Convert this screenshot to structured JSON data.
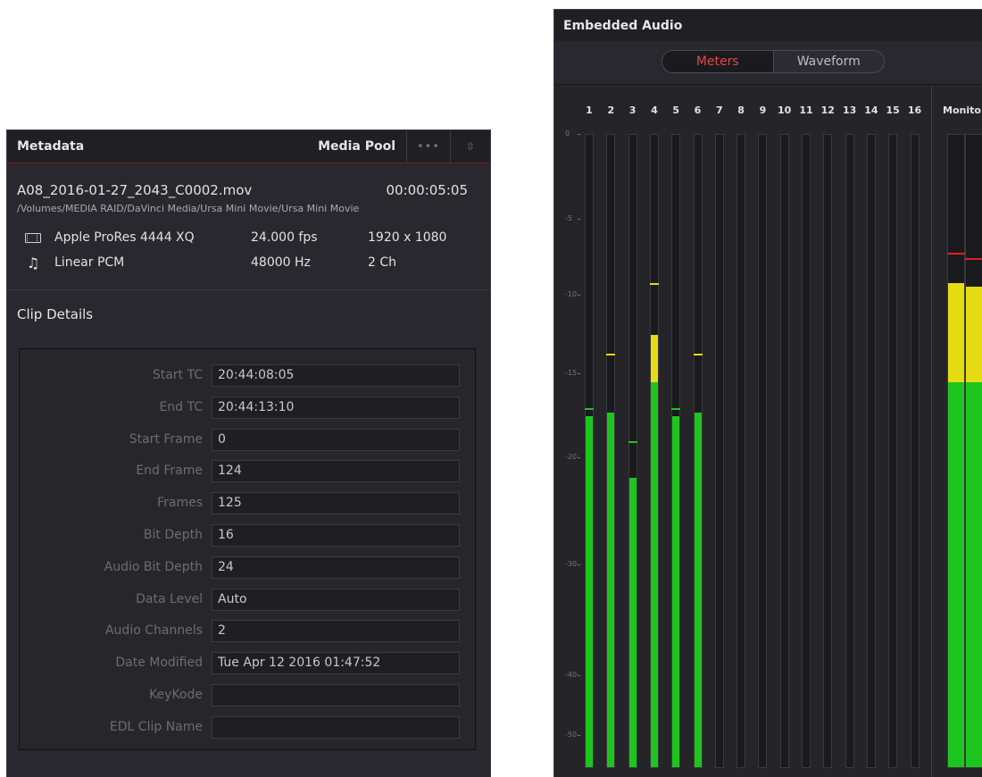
{
  "metadata_panel": {
    "title": "Metadata",
    "media_pool_label": "Media Pool",
    "more_label": "•••",
    "sort_label": "⇳",
    "file_name": "A08_2016-01-27_2043_C0002.mov",
    "duration": "00:00:05:05",
    "file_path": "/Volumes/MEDIA RAID/DaVinci Media/Ursa Mini Movie/Ursa Mini Movie",
    "video": {
      "icon": "film-icon",
      "codec": "Apple ProRes 4444 XQ",
      "fps": "24.000 fps",
      "resolution": "1920 x 1080"
    },
    "audio": {
      "icon": "music-note-icon",
      "codec": "Linear PCM",
      "rate": "48000 Hz",
      "channels": "2 Ch"
    },
    "clip_details_title": "Clip Details",
    "details": [
      {
        "label": "Start TC",
        "value": "20:44:08:05"
      },
      {
        "label": "End TC",
        "value": "20:44:13:10"
      },
      {
        "label": "Start Frame",
        "value": "0"
      },
      {
        "label": "End Frame",
        "value": "124"
      },
      {
        "label": "Frames",
        "value": "125"
      },
      {
        "label": "Bit Depth",
        "value": "16"
      },
      {
        "label": "Audio Bit Depth",
        "value": "24"
      },
      {
        "label": "Data Level",
        "value": "Auto"
      },
      {
        "label": "Audio Channels",
        "value": "2"
      },
      {
        "label": "Date Modified",
        "value": "Tue Apr 12 2016 01:47:52"
      },
      {
        "label": "KeyKode",
        "value": ""
      },
      {
        "label": "EDL Clip Name",
        "value": ""
      }
    ]
  },
  "audio_panel": {
    "title": "Embedded Audio",
    "tabs": [
      {
        "label": "Meters",
        "active": true
      },
      {
        "label": "Waveform",
        "active": false
      }
    ],
    "scale": [
      "0",
      "-5",
      "-10",
      "-15",
      "-20",
      "-30",
      "-40",
      "-50"
    ],
    "monitor_label": "Monito",
    "colors": {
      "green": "#1ec51e",
      "yellow": "#e6dc14",
      "peak_red": "#e02020",
      "active_tab": "#e64545"
    },
    "channels": [
      {
        "label": "1",
        "level_db": -17.5,
        "peak_db": -17.0
      },
      {
        "label": "2",
        "level_db": -17.3,
        "peak_db": -13.7
      },
      {
        "label": "3",
        "level_db": -21.8,
        "peak_db": -19.0
      },
      {
        "label": "4",
        "level_db": -12.5,
        "peak_db": -9.2
      },
      {
        "label": "5",
        "level_db": -17.5,
        "peak_db": -17.0
      },
      {
        "label": "6",
        "level_db": -17.3,
        "peak_db": -13.7
      },
      {
        "label": "7",
        "level_db": null,
        "peak_db": null
      },
      {
        "label": "8",
        "level_db": null,
        "peak_db": null
      },
      {
        "label": "9",
        "level_db": null,
        "peak_db": null
      },
      {
        "label": "10",
        "level_db": null,
        "peak_db": null
      },
      {
        "label": "11",
        "level_db": null,
        "peak_db": null
      },
      {
        "label": "12",
        "level_db": null,
        "peak_db": null
      },
      {
        "label": "13",
        "level_db": null,
        "peak_db": null
      },
      {
        "label": "14",
        "level_db": null,
        "peak_db": null
      },
      {
        "label": "15",
        "level_db": null,
        "peak_db": null
      },
      {
        "label": "16",
        "level_db": null,
        "peak_db": null
      }
    ],
    "monitor_channels": [
      {
        "level_db": -9.2,
        "peak_db": -7.2
      },
      {
        "level_db": -9.4,
        "peak_db": -7.5
      }
    ]
  }
}
